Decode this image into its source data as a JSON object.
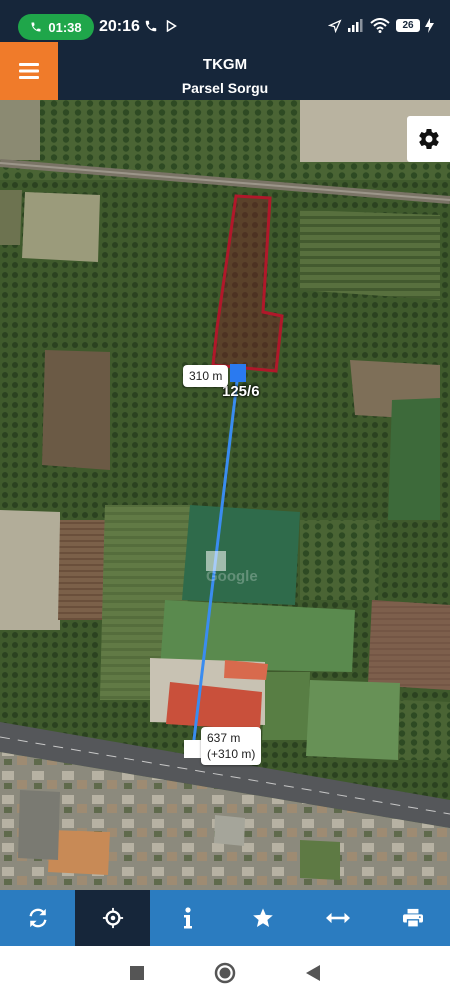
{
  "status_bar": {
    "call_duration": "01:38",
    "time": "20:16",
    "battery_level": "26"
  },
  "header": {
    "title": "TKGM",
    "subtitle": "Parsel Sorgu"
  },
  "map": {
    "parcel_label": "125/6",
    "measure_start_label": "310 m",
    "measure_end_label_line1": "637 m",
    "measure_end_label_line2": "(+310 m)",
    "watermark": "Google"
  },
  "toolbar": {
    "items": [
      {
        "icon": "refresh-icon"
      },
      {
        "icon": "crosshair-icon",
        "active": true
      },
      {
        "icon": "info-icon"
      },
      {
        "icon": "star-icon"
      },
      {
        "icon": "measure-icon"
      },
      {
        "icon": "print-icon"
      }
    ]
  },
  "colors": {
    "header_bg": "#16263a",
    "menu_accent": "#f07b2a",
    "toolbar_bg": "#2b7cc0",
    "parcel_outline": "#b0182a",
    "measure_line": "#3a8cf0",
    "call_pill": "#1fa64a"
  }
}
